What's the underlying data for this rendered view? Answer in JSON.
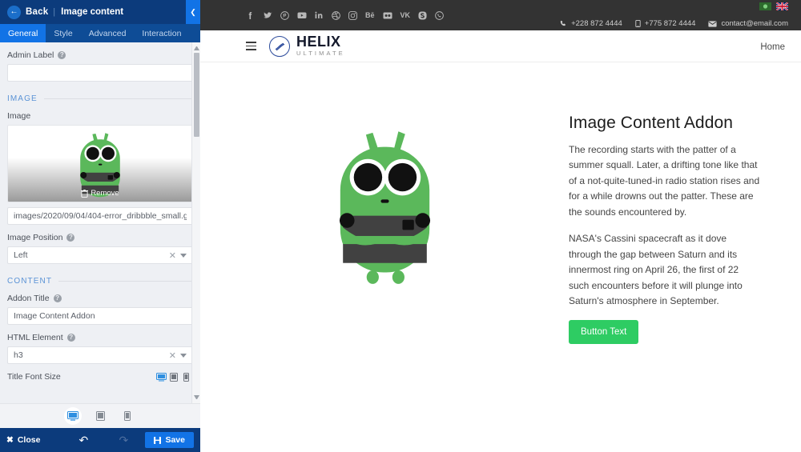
{
  "panel": {
    "back_label": "Back",
    "separator": "|",
    "title": "Image content",
    "collapse_icon": "chevron-left-icon",
    "tabs": [
      {
        "label": "General",
        "active": true
      },
      {
        "label": "Style",
        "active": false
      },
      {
        "label": "Advanced",
        "active": false
      },
      {
        "label": "Interaction",
        "active": false
      }
    ],
    "fields": {
      "admin_label": {
        "label": "Admin Label",
        "value": "",
        "placeholder": ""
      },
      "image_section": "IMAGE",
      "image_label": "Image",
      "remove_label": "Remove",
      "image_path": "images/2020/09/04/404-error_dribbble_small.gif",
      "image_position": {
        "label": "Image Position",
        "value": "Left"
      },
      "content_section": "CONTENT",
      "addon_title": {
        "label": "Addon Title",
        "value": "Image Content Addon"
      },
      "html_element": {
        "label": "HTML Element",
        "value": "h3"
      },
      "title_font_size": {
        "label": "Title Font Size"
      }
    },
    "device_icons": [
      "desktop-icon",
      "tablet-icon",
      "mobile-icon"
    ],
    "footer": {
      "close_label": "Close",
      "undo_icon": "undo-icon",
      "redo_icon": "redo-icon",
      "save_label": "Save"
    }
  },
  "preview": {
    "topbar": {
      "social": [
        "facebook-icon",
        "twitter-icon",
        "pinterest-icon",
        "youtube-icon",
        "linkedin-icon",
        "dribbble-icon",
        "instagram-icon",
        "behance-icon",
        "flickr-icon",
        "vk-icon",
        "skype-icon",
        "whatsapp-icon"
      ],
      "phone": "+228 872 4444",
      "mobile": "+775 872 4444",
      "email": "contact@email.com",
      "flags": [
        "flag-green",
        "flag-uk"
      ]
    },
    "navbar": {
      "menu_icon": "hamburger-icon",
      "logo_name": "HELIX",
      "logo_sub": "ULTIMATE",
      "links": [
        {
          "label": "Home"
        }
      ]
    },
    "content": {
      "title": "Image Content Addon",
      "paragraph1": "The recording starts with the patter of a summer squall. Later, a drifting tone like that of a not-quite-tuned-in radio station rises and for a while drowns out the patter. These are the sounds encountered by.",
      "paragraph2": "NASA's Cassini spacecraft as it dove through the gap between Saturn and its innermost ring on April 26, the first of 22 such encounters before it will plunge into Saturn's atmosphere in September.",
      "button_label": "Button Text",
      "image_alt": "green-mascot-illustration"
    }
  },
  "colors": {
    "panel_header": "#0c3b7c",
    "tab_active": "#1273e6",
    "accent_blue": "#1273e6",
    "button_green": "#2ecc63",
    "topbar_dark": "#333333"
  }
}
